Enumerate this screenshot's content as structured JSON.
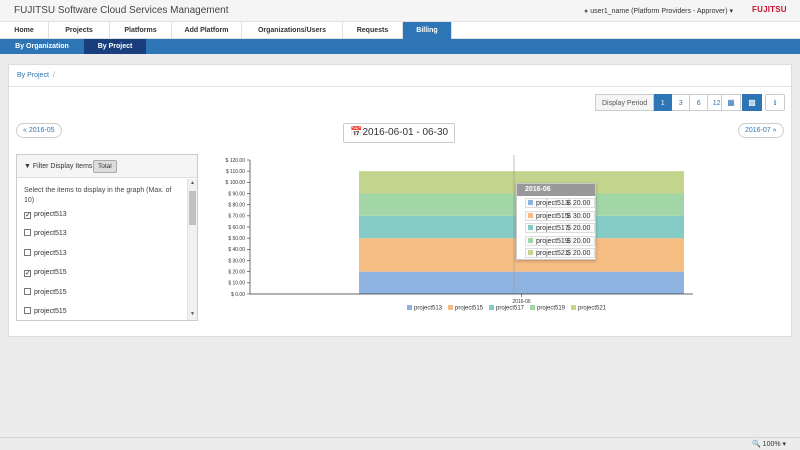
{
  "header": {
    "app_title": "FUJITSU Software Cloud Services Management",
    "user": "user1_name (Platform Providers - Approver)",
    "logo": "FUJITSU"
  },
  "nav": {
    "tabs": [
      "Home",
      "Projects",
      "Platforms",
      "Add Platform",
      "Organizations/Users",
      "Requests",
      "Billing"
    ],
    "active": "Billing"
  },
  "subnav": {
    "tabs": [
      "By Organization",
      "By Project"
    ],
    "active": "By Project"
  },
  "breadcrumb": {
    "current": "By Project",
    "sep": "/"
  },
  "period": {
    "label": "Display Period",
    "options": [
      "1",
      "3",
      "6",
      "12"
    ],
    "active": "1"
  },
  "pager": {
    "prev": "« 2016-05",
    "next": "2016-07 »",
    "range": "2016-06-01 - 06-30"
  },
  "filter": {
    "title": "Filter Display Items",
    "total_label": "Total",
    "description": "Select the items to display in the graph (Max. of 10)",
    "items": [
      {
        "label": "project513",
        "checked": true
      },
      {
        "label": "project513",
        "checked": false
      },
      {
        "label": "project513",
        "checked": false
      },
      {
        "label": "project515",
        "checked": true
      },
      {
        "label": "project515",
        "checked": false
      },
      {
        "label": "project515",
        "checked": false
      }
    ]
  },
  "chart_data": {
    "type": "bar",
    "stacked": true,
    "categories": [
      "2016-06"
    ],
    "y_tick_labels": [
      "$ 0.00",
      "$ 10.00",
      "$ 20.00",
      "$ 30.00",
      "$ 40.00",
      "$ 50.00",
      "$ 60.00",
      "$ 70.00",
      "$ 80.00",
      "$ 90.00",
      "$ 100.00",
      "$ 110.00",
      "$ 120.00"
    ],
    "ylim": [
      0,
      120
    ],
    "legend_position": "bottom",
    "series": [
      {
        "name": "project513",
        "values": [
          20
        ],
        "color": "#8fb3e0"
      },
      {
        "name": "project515",
        "values": [
          30
        ],
        "color": "#f5bd82"
      },
      {
        "name": "project517",
        "values": [
          20
        ],
        "color": "#84cbc6"
      },
      {
        "name": "project519",
        "values": [
          20
        ],
        "color": "#a3d6a6"
      },
      {
        "name": "project521",
        "values": [
          20
        ],
        "color": "#c3d48d"
      }
    ]
  },
  "tooltip": {
    "title": "2016-06",
    "rows": [
      {
        "name": "project513",
        "value": "$ 20.00"
      },
      {
        "name": "project515",
        "value": "$ 30.00"
      },
      {
        "name": "project517",
        "value": "$ 20.00"
      },
      {
        "name": "project519",
        "value": "$ 20.00"
      },
      {
        "name": "project521",
        "value": "$ 20.00"
      }
    ]
  },
  "status": {
    "zoom": "100%"
  },
  "colors": {
    "primary": "#2e75b6",
    "subnav_active": "#1a3e7c",
    "brand_red": "#c8102e"
  }
}
